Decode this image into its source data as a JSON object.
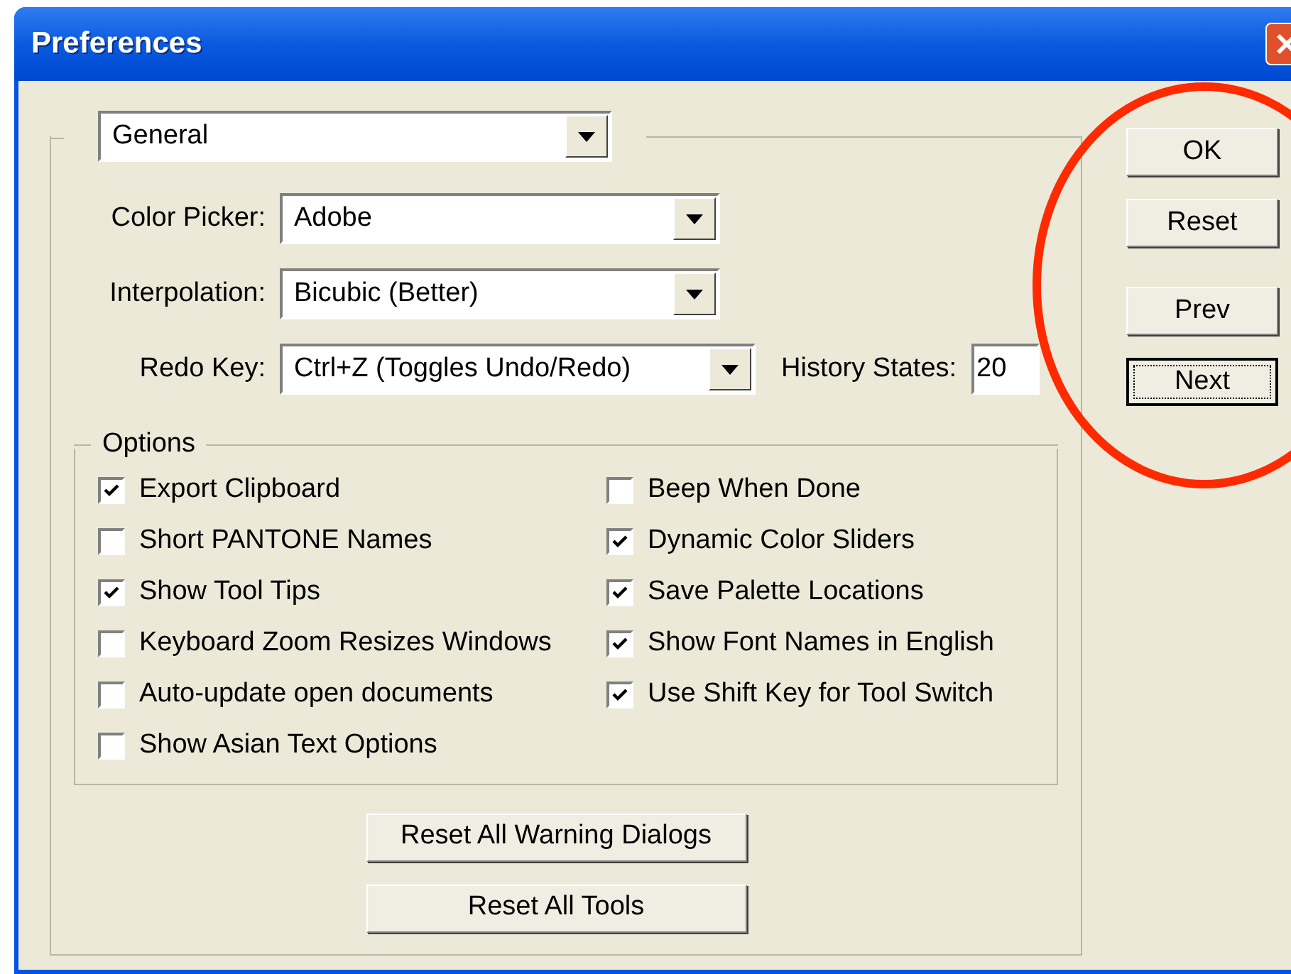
{
  "window": {
    "title": "Preferences"
  },
  "section": {
    "value": "General"
  },
  "fields": [
    {
      "label": "Color Picker:",
      "value": "Adobe"
    },
    {
      "label": "Interpolation:",
      "value": "Bicubic (Better)"
    },
    {
      "label": "Redo Key:",
      "value": "Ctrl+Z (Toggles Undo/Redo)",
      "history_states": {
        "label": "History States:",
        "value": "20"
      }
    }
  ],
  "options": {
    "title": "Options",
    "columns": [
      [
        {
          "label": "Export Clipboard",
          "checked": true
        },
        {
          "label": "Short PANTONE Names",
          "checked": false
        },
        {
          "label": "Show Tool Tips",
          "checked": true
        },
        {
          "label": "Keyboard Zoom Resizes Windows",
          "checked": false
        },
        {
          "label": "Auto-update open documents",
          "checked": false
        },
        {
          "label": "Show Asian Text Options",
          "checked": false
        }
      ],
      [
        {
          "label": "Beep When Done",
          "checked": false
        },
        {
          "label": "Dynamic Color Sliders",
          "checked": true
        },
        {
          "label": "Save Palette Locations",
          "checked": true
        },
        {
          "label": "Show Font Names in English",
          "checked": true
        },
        {
          "label": "Use Shift Key for Tool Switch",
          "checked": true
        }
      ]
    ]
  },
  "reset_buttons": [
    {
      "label": "Reset All Warning Dialogs"
    },
    {
      "label": "Reset All Tools"
    }
  ],
  "buttons": [
    {
      "label": "OK",
      "focused": false
    },
    {
      "label": "Reset",
      "focused": false
    },
    {
      "label": "Prev",
      "focused": false
    },
    {
      "label": "Next",
      "focused": true
    }
  ]
}
